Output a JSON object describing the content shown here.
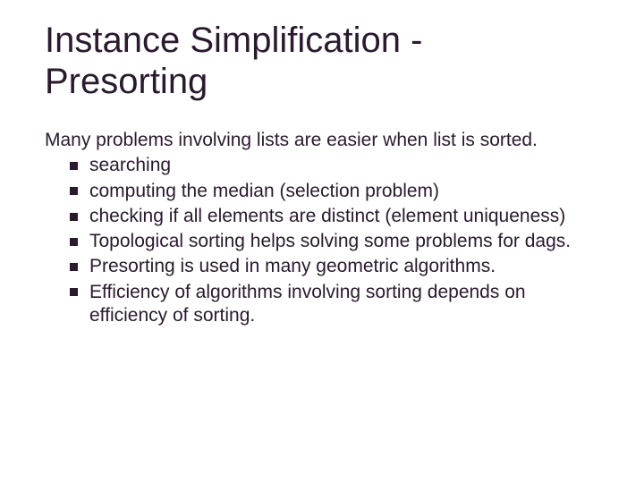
{
  "title_line1": "Instance Simplification -",
  "title_line2": "Presorting",
  "intro": "Many problems involving lists are easier when list is sorted.",
  "bullets": [
    "searching",
    "computing the median (selection problem)",
    "checking if all elements  are distinct (element uniqueness)",
    "Topological sorting helps solving some problems for dags.",
    "Presorting is used in many geometric algorithms.",
    "Efficiency of algorithms involving sorting depends on efficiency of sorting."
  ]
}
